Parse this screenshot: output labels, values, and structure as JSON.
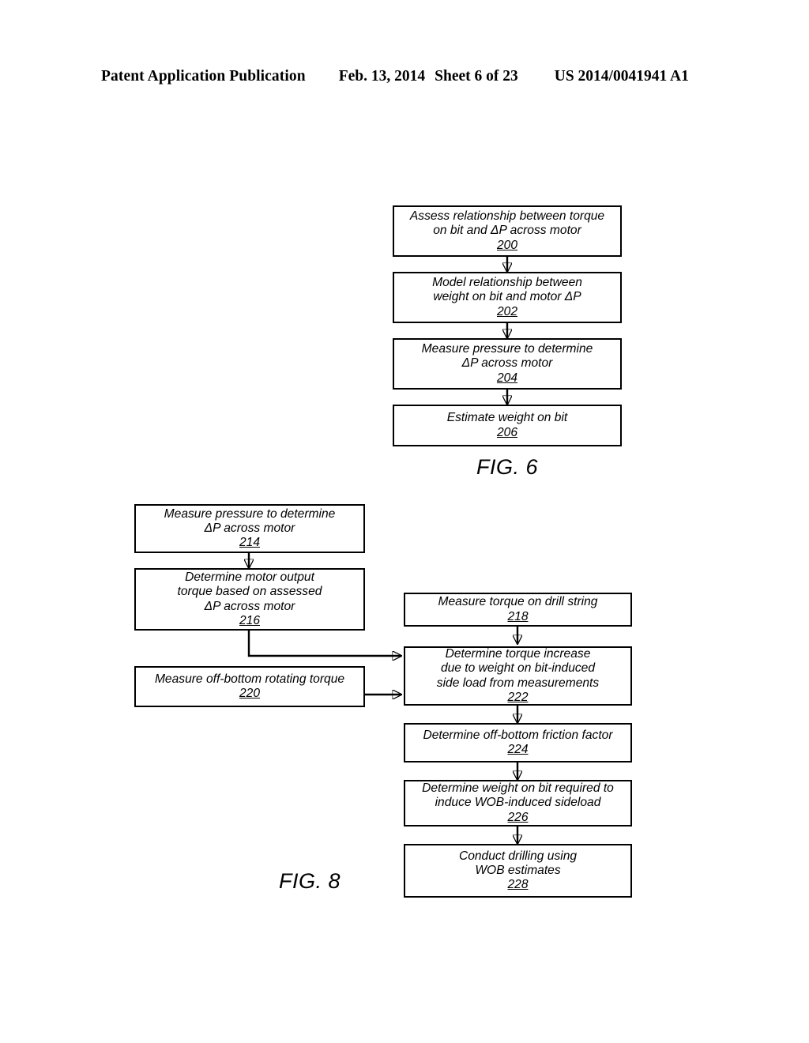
{
  "header": {
    "title": "Patent Application Publication",
    "date": "Feb. 13, 2014",
    "sheet": "Sheet 6 of 23",
    "pub_number": "US 2014/0041941 A1"
  },
  "figures": [
    {
      "caption": "FIG. 6",
      "boxes": [
        {
          "ref": "200",
          "text": "Assess relationship between torque\non bit and ΔP across motor"
        },
        {
          "ref": "202",
          "text": "Model relationship between\nweight on bit and motor  ΔP"
        },
        {
          "ref": "204",
          "text": "Measure pressure to determine\nΔP across motor"
        },
        {
          "ref": "206",
          "text": "Estimate weight on bit"
        }
      ]
    },
    {
      "caption": "FIG. 8",
      "boxes": [
        {
          "ref": "214",
          "text": "Measure pressure to determine\nΔP across motor"
        },
        {
          "ref": "216",
          "text": "Determine motor output\ntorque based on assessed\nΔP across motor"
        },
        {
          "ref": "220",
          "text": "Measure off-bottom rotating torque"
        },
        {
          "ref": "218",
          "text": "Measure torque on drill string"
        },
        {
          "ref": "222",
          "text": "Determine torque increase\ndue to weight on bit-induced\nside load from measurements"
        },
        {
          "ref": "224",
          "text": "Determine off-bottom friction factor"
        },
        {
          "ref": "226",
          "text": "Determine weight on bit required to\ninduce WOB-induced sideload"
        },
        {
          "ref": "228",
          "text": "Conduct drilling using\nWOB estimates"
        }
      ]
    }
  ],
  "colors": {
    "ink": "#000000",
    "paper": "#ffffff"
  }
}
